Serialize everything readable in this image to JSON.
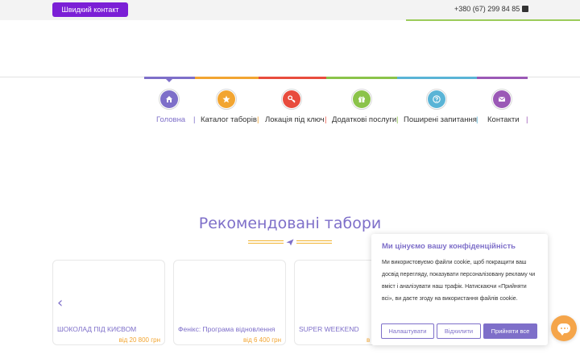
{
  "topbar": {
    "quick_contact_label": "Швидкий контакт",
    "phone": "+380 (67) 299 84 85"
  },
  "menu": {
    "items": [
      {
        "label": "Головна",
        "icon": "home-icon",
        "color": "#7e6fc9",
        "active": true
      },
      {
        "label": "Каталог таборів",
        "icon": "star-icon",
        "color": "#f2a531",
        "active": false
      },
      {
        "label": "Локація під ключ",
        "icon": "key-icon",
        "color": "#e84c3d",
        "active": false
      },
      {
        "label": "Додаткові послуги",
        "icon": "gift-icon",
        "color": "#8bc34a",
        "active": false
      },
      {
        "label": "Поширені запитання",
        "icon": "question-icon",
        "color": "#5ab4d6",
        "active": false
      },
      {
        "label": "Контакти",
        "icon": "envelope-icon",
        "color": "#9b59b6",
        "active": false
      }
    ],
    "separator": "|"
  },
  "section": {
    "title": "Рекомендовані табори"
  },
  "camps": [
    {
      "title": "ШОКОЛАД ПІД КИЄВОМ",
      "price": "від 20 800 грн"
    },
    {
      "title": "Фенікс: Програма відновлення",
      "price": "від 6 400 грн"
    },
    {
      "title": "SUPER WEEKEND",
      "price": "в"
    }
  ],
  "cookie": {
    "title": "Ми цінуємо вашу конфіденційність",
    "text": "Ми використовуємо файли cookie, щоб покращити ваш досвід перегляду, показувати персоналізовану рекламу чи вміст і аналізувати наш трафік. Натискаючи «Прийняти всі», ви даєте згоду на використання файлів cookie.",
    "customize_label": "Налаштувати",
    "reject_label": "Відхилити",
    "accept_label": "Прийняти все"
  },
  "colors": {
    "brand_purple": "#7e6fc9",
    "quick_contact": "#7b1fd6",
    "price_orange": "#f2a531",
    "chat_orange": "#f5a54a"
  }
}
